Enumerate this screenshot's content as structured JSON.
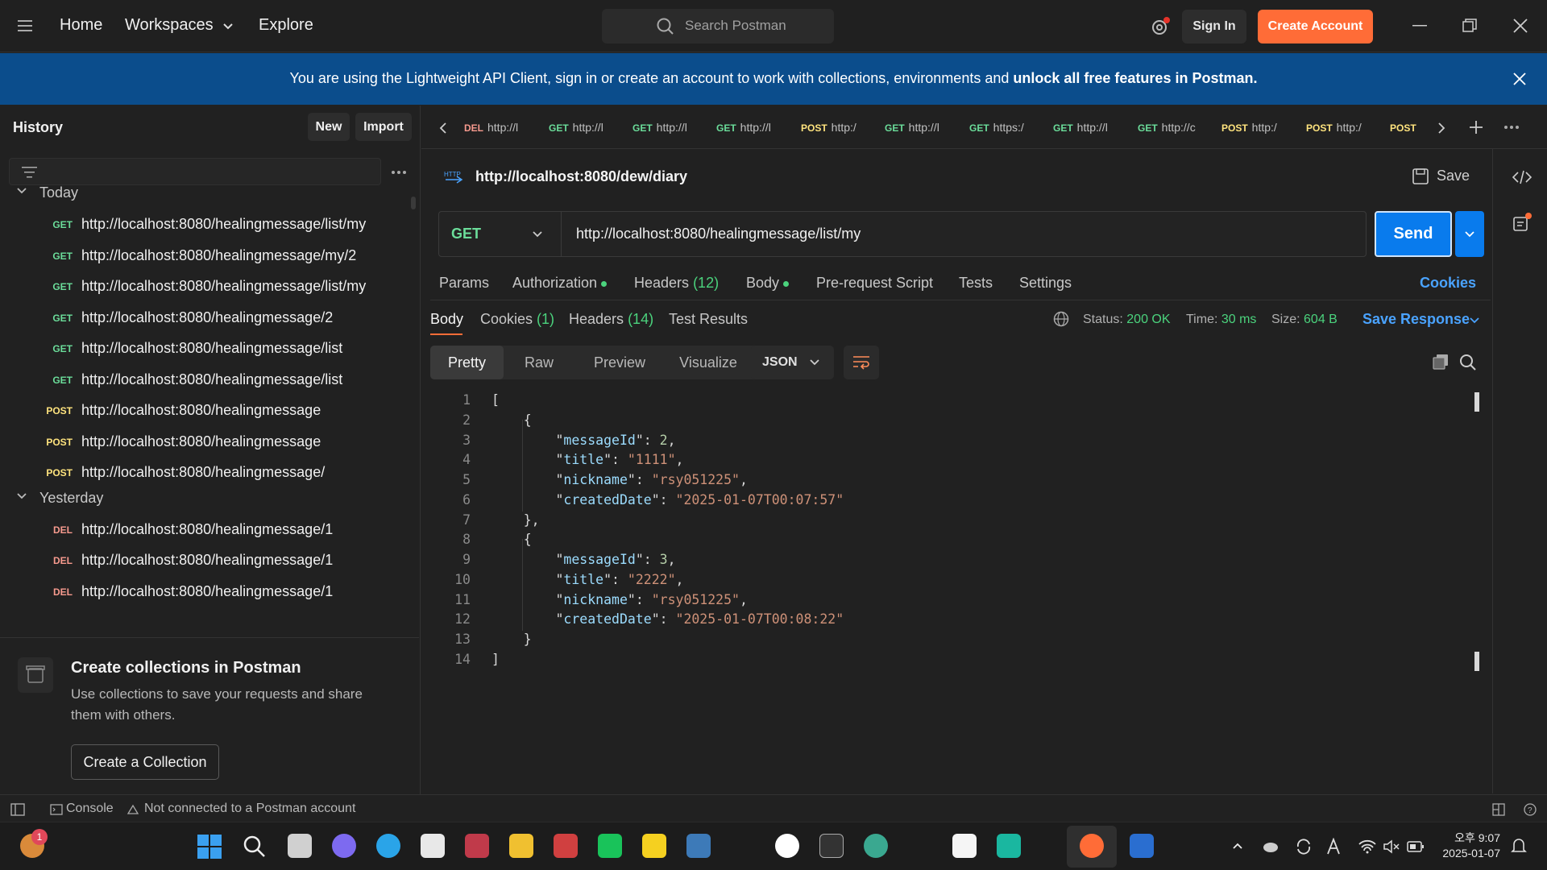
{
  "topbar": {
    "home": "Home",
    "workspaces": "Workspaces",
    "explore": "Explore",
    "search_placeholder": "Search Postman",
    "sign_in": "Sign In",
    "create_account": "Create Account"
  },
  "banner": {
    "text": "You are using the Lightweight API Client, sign in or create an account to work with collections, environments and ",
    "bold": "unlock all free features in Postman."
  },
  "sidebar": {
    "title": "History",
    "new_label": "New",
    "import_label": "Import",
    "groups": [
      {
        "label": "Today",
        "items": [
          {
            "method": "GET",
            "url": "http://localhost:8080/healingmessage/list/my"
          },
          {
            "method": "GET",
            "url": "http://localhost:8080/healingmessage/my/2"
          },
          {
            "method": "GET",
            "url": "http://localhost:8080/healingmessage/list/my"
          },
          {
            "method": "GET",
            "url": "http://localhost:8080/healingmessage/2"
          },
          {
            "method": "GET",
            "url": "http://localhost:8080/healingmessage/list"
          },
          {
            "method": "GET",
            "url": "http://localhost:8080/healingmessage/list"
          },
          {
            "method": "POST",
            "url": "http://localhost:8080/healingmessage"
          },
          {
            "method": "POST",
            "url": "http://localhost:8080/healingmessage"
          },
          {
            "method": "POST",
            "url": "http://localhost:8080/healingmessage/"
          }
        ]
      },
      {
        "label": "Yesterday",
        "items": [
          {
            "method": "DEL",
            "url": "http://localhost:8080/healingmessage/1"
          },
          {
            "method": "DEL",
            "url": "http://localhost:8080/healingmessage/1"
          },
          {
            "method": "DEL",
            "url": "http://localhost:8080/healingmessage/1"
          }
        ]
      }
    ],
    "collections_card": {
      "title": "Create collections in Postman",
      "description": "Use collections to save your requests and share them with others.",
      "button": "Create a Collection"
    }
  },
  "tabs": [
    {
      "method": "DEL",
      "url": "http://l"
    },
    {
      "method": "GET",
      "url": "http://l"
    },
    {
      "method": "GET",
      "url": "http://l"
    },
    {
      "method": "GET",
      "url": "http://l"
    },
    {
      "method": "POST",
      "url": "http:/"
    },
    {
      "method": "GET",
      "url": "http://l"
    },
    {
      "method": "GET",
      "url": "https:/"
    },
    {
      "method": "GET",
      "url": "http://l"
    },
    {
      "method": "GET",
      "url": "http://c"
    },
    {
      "method": "POST",
      "url": "http:/"
    },
    {
      "method": "POST",
      "url": "http:/"
    },
    {
      "method": "POST",
      "url": ""
    }
  ],
  "request": {
    "title": "http://localhost:8080/dew/diary",
    "save_label": "Save",
    "method": "GET",
    "url": "http://localhost:8080/healingmessage/list/my",
    "send_label": "Send",
    "tabs": {
      "params": "Params",
      "authorization": "Authorization",
      "headers": "Headers",
      "headers_count": "(12)",
      "body": "Body",
      "pre_request": "Pre-request Script",
      "tests": "Tests",
      "settings": "Settings",
      "cookies": "Cookies"
    }
  },
  "response": {
    "tabs": {
      "body": "Body",
      "cookies": "Cookies",
      "cookies_count": "(1)",
      "headers": "Headers",
      "headers_count": "(14)",
      "test_results": "Test Results"
    },
    "status_label": "Status:",
    "status": "200 OK",
    "time_label": "Time:",
    "time": "30 ms",
    "size_label": "Size:",
    "size": "604 B",
    "save_response": "Save Response",
    "views": [
      "Pretty",
      "Raw",
      "Preview",
      "Visualize"
    ],
    "format": "JSON",
    "code_lines": [
      {
        "n": "1",
        "text": "["
      },
      {
        "n": "2",
        "text": "    {"
      },
      {
        "n": "3",
        "key": "messageId",
        "num": "2"
      },
      {
        "n": "4",
        "key": "title",
        "str": "1111"
      },
      {
        "n": "5",
        "key": "nickname",
        "str": "rsy051225"
      },
      {
        "n": "6",
        "key": "createdDate",
        "str": "2025-01-07T00:07:57",
        "last": true
      },
      {
        "n": "7",
        "text": "    },"
      },
      {
        "n": "8",
        "text": "    {"
      },
      {
        "n": "9",
        "key": "messageId",
        "num": "3"
      },
      {
        "n": "10",
        "key": "title",
        "str": "2222"
      },
      {
        "n": "11",
        "key": "nickname",
        "str": "rsy051225"
      },
      {
        "n": "12",
        "key": "createdDate",
        "str": "2025-01-07T00:08:22",
        "last": true
      },
      {
        "n": "13",
        "text": "    }"
      },
      {
        "n": "14",
        "text": "]"
      }
    ]
  },
  "statusbar": {
    "console": "Console",
    "connection": "Not connected to a Postman account"
  },
  "taskbar": {
    "time": "오후 9:07",
    "date": "2025-01-07",
    "notification_count": "1"
  },
  "colors": {
    "accent": "#ff6c37",
    "send": "#097bed",
    "get": "#6bdd9a",
    "post": "#ffe47e",
    "del": "#f79a8e"
  }
}
